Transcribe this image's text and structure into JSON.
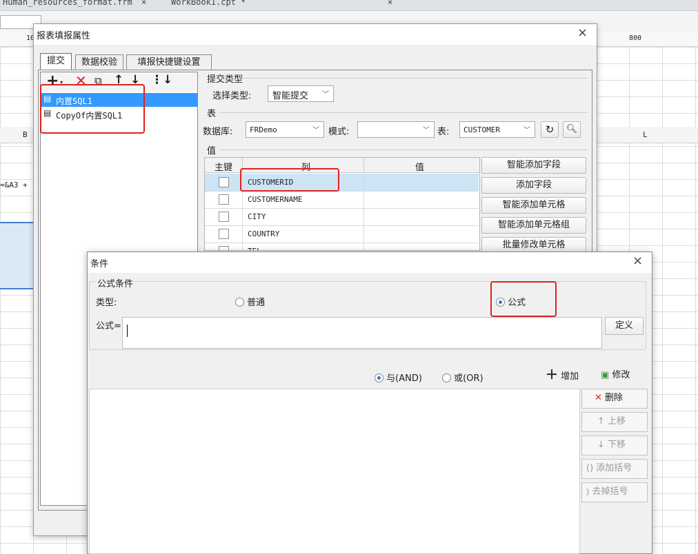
{
  "background": {
    "tabs": [
      "Human_resources_format.frm",
      "WorkBook1.cpt *"
    ],
    "ruler_marks": [
      "10",
      "800"
    ],
    "column_headers": [
      "B",
      "L"
    ],
    "formula_fragment": "=&A3 +"
  },
  "main_dialog": {
    "title": "报表填报属性",
    "tabs": [
      "提交",
      "数据校验",
      "填报快捷键设置"
    ],
    "tree_items": [
      "内置SQL1",
      "CopyOf内置SQL1"
    ],
    "section_submit_type": "提交类型",
    "select_type_label": "选择类型:",
    "select_type_value": "智能提交",
    "section_table": "表",
    "database_label": "数据库:",
    "database_value": "FRDemo",
    "schema_label": "模式:",
    "schema_value": "",
    "table_label": "表:",
    "table_value": "CUSTOMER",
    "section_value": "值",
    "table_headers": [
      "主键",
      "列",
      "值"
    ],
    "rows": [
      {
        "column": "CUSTOMERID",
        "value": ""
      },
      {
        "column": "CUSTOMERNAME",
        "value": ""
      },
      {
        "column": "CITY",
        "value": ""
      },
      {
        "column": "COUNTRY",
        "value": ""
      },
      {
        "column": "TEL",
        "value": ""
      }
    ],
    "side_buttons": [
      "智能添加字段",
      "添加字段",
      "智能添加单元格",
      "智能添加单元格组",
      "批量修改单元格"
    ]
  },
  "condition_dialog": {
    "title": "条件",
    "group_title": "公式条件",
    "type_label": "类型:",
    "radio_normal": "普通",
    "radio_formula": "公式",
    "selected_type": "formula",
    "formula_label": "公式=",
    "formula_value": "",
    "define_button": "定义",
    "logic_and": "与(AND)",
    "logic_or": "或(OR)",
    "selected_logic": "and",
    "add_button": "增加",
    "modify_button": "修改",
    "delete_button": "删除",
    "move_up_button": "上移",
    "move_down_button": "下移",
    "add_bracket_button": "添加括号",
    "remove_bracket_button": "去掉括号"
  },
  "colors": {
    "highlight_red": "#e0201e",
    "selection_blue": "#3399ff",
    "selected_row": "#cde4f5",
    "delete_red": "#e02020"
  }
}
